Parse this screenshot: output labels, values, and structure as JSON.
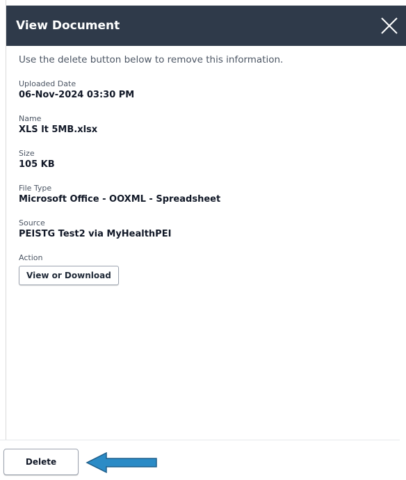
{
  "dialog": {
    "title": "View Document",
    "instruction": "Use the delete button below to remove this information."
  },
  "fields": {
    "uploaded_date": {
      "label": "Uploaded Date",
      "value": "06-Nov-2024 03:30 PM"
    },
    "name": {
      "label": "Name",
      "value": "XLS lt 5MB.xlsx"
    },
    "size": {
      "label": "Size",
      "value": "105 KB"
    },
    "file_type": {
      "label": "File Type",
      "value": "Microsoft Office - OOXML - Spreadsheet"
    },
    "source": {
      "label": "Source",
      "value": "PEISTG Test2 via MyHealthPEI"
    },
    "action": {
      "label": "Action",
      "button_label": "View or Download"
    }
  },
  "footer": {
    "delete_label": "Delete"
  },
  "colors": {
    "header_bg": "#2f3a4a",
    "arrow": "#2b8bc6"
  },
  "icons": {
    "close": "close-icon",
    "arrow": "arrow-left-icon"
  }
}
